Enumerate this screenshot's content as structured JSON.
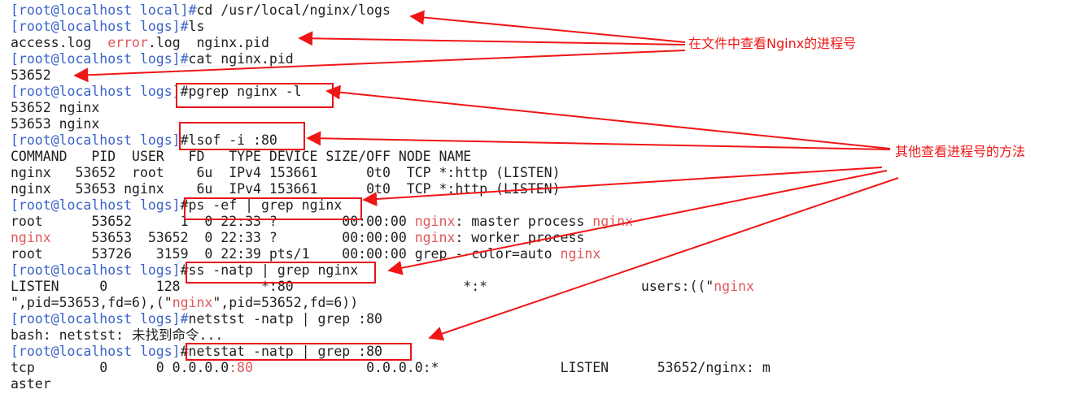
{
  "terminal": {
    "top_partial": "",
    "lines": [
      {
        "segs": [
          {
            "t": "[root@localhost local]#",
            "c": "p"
          },
          {
            "t": "cd /usr/local/nginx/logs"
          }
        ]
      },
      {
        "segs": [
          {
            "t": "[root@localhost logs]#",
            "c": "p"
          },
          {
            "t": "ls"
          }
        ]
      },
      {
        "segs": [
          {
            "t": "access.log  "
          },
          {
            "t": "error",
            "c": "r"
          },
          {
            "t": ".log  nginx.pid"
          }
        ]
      },
      {
        "segs": [
          {
            "t": "[root@localhost logs]#",
            "c": "p"
          },
          {
            "t": "cat nginx.pid"
          }
        ]
      },
      {
        "segs": [
          {
            "t": "53652"
          }
        ]
      },
      {
        "segs": [
          {
            "t": "[root@localhost logs]",
            "c": "p"
          },
          {
            "t": "#pgrep nginx -l"
          }
        ]
      },
      {
        "segs": [
          {
            "t": "53652 nginx"
          }
        ]
      },
      {
        "segs": [
          {
            "t": "53653 nginx"
          }
        ]
      },
      {
        "segs": [
          {
            "t": "[root@localhost logs]",
            "c": "p"
          },
          {
            "t": "#lsof -i :80"
          }
        ]
      },
      {
        "segs": [
          {
            "t": "COMMAND   PID  USER   FD   TYPE DEVICE SIZE/OFF NODE NAME"
          }
        ]
      },
      {
        "segs": [
          {
            "t": "nginx   53652  root    6u  IPv4 153661      0t0  TCP *:http (LISTEN)"
          }
        ]
      },
      {
        "segs": [
          {
            "t": "nginx   53653 nginx    6u  IPv4 153661      0t0  TCP *:http (LISTEN)"
          }
        ]
      },
      {
        "segs": [
          {
            "t": "[root@localhost logs]",
            "c": "p"
          },
          {
            "t": "#ps -ef | grep nginx"
          }
        ]
      },
      {
        "segs": [
          {
            "t": "root      53652      1  0 22:33 ?        00:00:00 "
          },
          {
            "t": "nginx",
            "c": "r"
          },
          {
            "t": ": master process "
          },
          {
            "t": "nginx",
            "c": "r"
          }
        ]
      },
      {
        "segs": [
          {
            "t": "nginx",
            "c": "r"
          },
          {
            "t": "     53653  53652  0 22:33 ?        00:00:00 "
          },
          {
            "t": "nginx",
            "c": "r"
          },
          {
            "t": ": worker process"
          }
        ]
      },
      {
        "segs": [
          {
            "t": "root      53726   3159  0 22:39 pts/1    00:00:00 grep --color=auto "
          },
          {
            "t": "nginx",
            "c": "r"
          }
        ]
      },
      {
        "segs": [
          {
            "t": "[root@localhost logs]",
            "c": "p"
          },
          {
            "t": "#ss -natp | grep nginx"
          }
        ]
      },
      {
        "segs": [
          {
            "t": "LISTEN     0      128          *:80                     *:*                   users:((\""
          },
          {
            "t": "nginx",
            "c": "r"
          }
        ]
      },
      {
        "segs": [
          {
            "t": "\",pid=53653,fd=6),(\""
          },
          {
            "t": "nginx",
            "c": "r"
          },
          {
            "t": "\",pid=53652,fd=6))"
          }
        ]
      },
      {
        "segs": [
          {
            "t": "[root@localhost logs]#",
            "c": "p"
          },
          {
            "t": "netstst -natp | grep :80"
          }
        ]
      },
      {
        "segs": [
          {
            "t": "bash: netstst: 未找到命令..."
          }
        ]
      },
      {
        "segs": [
          {
            "t": "[root@localhost logs]",
            "c": "p"
          },
          {
            "t": "#netstat -natp | grep :80"
          }
        ]
      },
      {
        "segs": [
          {
            "t": "tcp        0      0 0.0.0.0"
          },
          {
            "t": ":80",
            "c": "r"
          },
          {
            "t": "              0.0.0.0:*               LISTEN      53652/nginx: m"
          }
        ]
      },
      {
        "segs": [
          {
            "t": "aster"
          }
        ]
      }
    ]
  },
  "annotations": {
    "note1": "在文件中查看Nginx的进程号",
    "note2": "其他查看进程号的方法"
  },
  "colors": {
    "prompt": "#3a63c8",
    "highlight": "#e0585a",
    "annotation": "#f01616"
  }
}
